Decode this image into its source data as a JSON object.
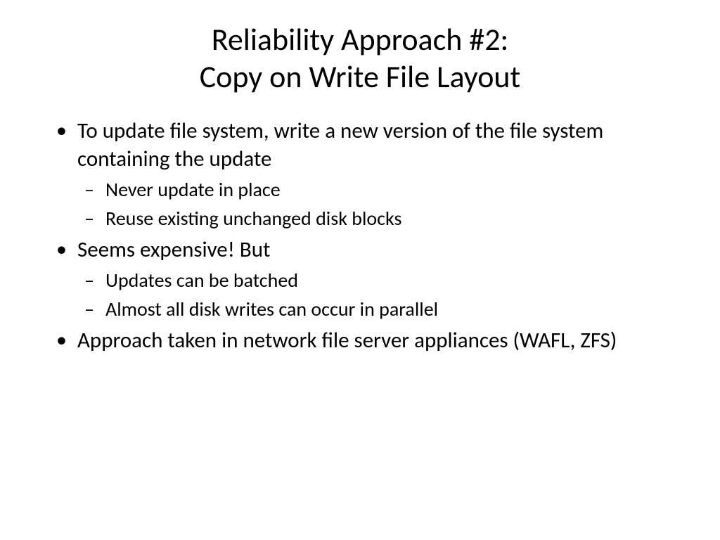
{
  "slide": {
    "title_line1": "Reliability Approach #2:",
    "title_line2": "Copy on Write File Layout",
    "bullets": [
      {
        "text": "To update file system, write a new version of the file system containing the update",
        "sub": [
          "Never update in place",
          "Reuse existing unchanged disk blocks"
        ]
      },
      {
        "text": "Seems expensive!  But",
        "sub": [
          "Updates can be batched",
          "Almost all disk writes can occur in parallel"
        ]
      },
      {
        "text": "Approach taken in network file server appliances (WAFL, ZFS)",
        "sub": []
      }
    ]
  }
}
